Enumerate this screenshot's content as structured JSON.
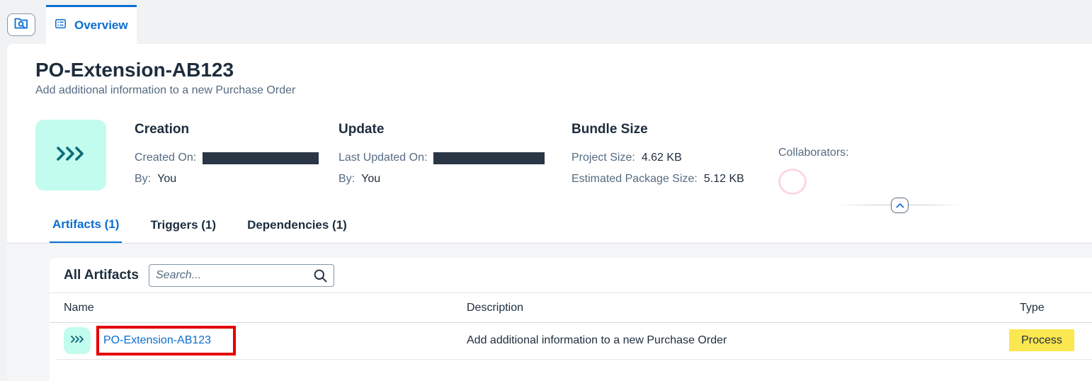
{
  "tabs_bar": {
    "overview_label": "Overview"
  },
  "project": {
    "title": "PO-Extension-AB123",
    "subtitle": "Add additional information to a new Purchase Order"
  },
  "creation": {
    "heading": "Creation",
    "created_on_label": "Created On:",
    "by_label": "By:",
    "by_value": "You"
  },
  "update": {
    "heading": "Update",
    "last_updated_label": "Last Updated On:",
    "by_label": "By:",
    "by_value": "You"
  },
  "bundle": {
    "heading": "Bundle Size",
    "project_size_label": "Project Size:",
    "project_size_value": "4.62 KB",
    "estimated_label": "Estimated Package Size:",
    "estimated_value": "5.12 KB"
  },
  "collaborators": {
    "label": "Collaborators:"
  },
  "section_tabs": [
    {
      "label": "Artifacts (1)",
      "active": true
    },
    {
      "label": "Triggers (1)",
      "active": false
    },
    {
      "label": "Dependencies (1)",
      "active": false
    }
  ],
  "artifacts": {
    "title": "All Artifacts",
    "search_placeholder": "Search...",
    "columns": {
      "name": "Name",
      "description": "Description",
      "type": "Type"
    },
    "rows": [
      {
        "name": "PO-Extension-AB123",
        "description": "Add additional information to a new Purchase Order",
        "type": "Process"
      }
    ]
  },
  "colors": {
    "accent": "#0a6ed1",
    "icon_bg": "#c2fcee",
    "icon_fg": "#0e6b78",
    "badge_bg": "#fbe74f",
    "highlight_border": "#e30000"
  },
  "icons": {
    "search_button": "folder-search-icon",
    "overview_tab": "list-icon",
    "project": "process-chevrons-icon",
    "collapse": "chevron-up-icon",
    "search": "search-icon"
  }
}
